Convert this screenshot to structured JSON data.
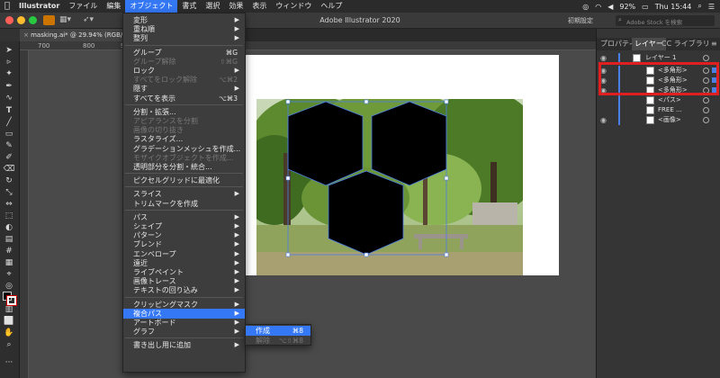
{
  "menubar": {
    "app": "Illustrator",
    "items": [
      "ファイル",
      "編集",
      "オブジェクト",
      "書式",
      "選択",
      "効果",
      "表示",
      "ウィンドウ",
      "ヘルプ"
    ],
    "active": "オブジェクト",
    "battery": "92%",
    "clock": "Thu 15:44"
  },
  "appbar": {
    "title": "Adobe Illustrator 2020",
    "workspace": "初期設定",
    "search_placeholder": "Adobe Stock を検索"
  },
  "document": {
    "tab_label": "masking.ai* @ 29.94% (RGB/GPU",
    "ruler_ticks": [
      "700",
      "800",
      "900"
    ]
  },
  "object_menu": {
    "rows": [
      {
        "label": "変形",
        "arrow": true
      },
      {
        "label": "重ね順",
        "arrow": true
      },
      {
        "label": "整列",
        "arrow": true
      },
      {
        "sep": true
      },
      {
        "label": "グループ",
        "shortcut": "⌘G"
      },
      {
        "label": "グループ解除",
        "shortcut": "⇧⌘G",
        "disabled": true
      },
      {
        "label": "ロック",
        "arrow": true
      },
      {
        "label": "すべてをロック解除",
        "shortcut": "⌥⌘2",
        "disabled": true
      },
      {
        "label": "隠す",
        "arrow": true
      },
      {
        "label": "すべてを表示",
        "shortcut": "⌥⌘3"
      },
      {
        "sep": true
      },
      {
        "label": "分割・拡張..."
      },
      {
        "label": "アピアランスを分割",
        "disabled": true
      },
      {
        "label": "画像の切り抜き",
        "disabled": true
      },
      {
        "label": "ラスタライズ..."
      },
      {
        "label": "グラデーションメッシュを作成..."
      },
      {
        "label": "モザイクオブジェクトを作成...",
        "disabled": true
      },
      {
        "label": "透明部分を分割・統合..."
      },
      {
        "sep": true
      },
      {
        "label": "ピクセルグリッドに最適化"
      },
      {
        "sep": true
      },
      {
        "label": "スライス",
        "arrow": true
      },
      {
        "label": "トリムマークを作成"
      },
      {
        "sep": true
      },
      {
        "label": "パス",
        "arrow": true
      },
      {
        "label": "シェイプ",
        "arrow": true
      },
      {
        "label": "パターン",
        "arrow": true
      },
      {
        "label": "ブレンド",
        "arrow": true
      },
      {
        "label": "エンベロープ",
        "arrow": true
      },
      {
        "label": "遠近",
        "arrow": true
      },
      {
        "label": "ライブペイント",
        "arrow": true
      },
      {
        "label": "画像トレース",
        "arrow": true
      },
      {
        "label": "テキストの回り込み",
        "arrow": true
      },
      {
        "sep": true
      },
      {
        "label": "クリッピングマスク",
        "arrow": true
      },
      {
        "label": "複合パス",
        "arrow": true,
        "highlight": true
      },
      {
        "label": "アートボード",
        "arrow": true
      },
      {
        "label": "グラフ",
        "arrow": true
      },
      {
        "sep": true
      },
      {
        "label": "書き出し用に追加",
        "arrow": true
      }
    ]
  },
  "compound_submenu": {
    "rows": [
      {
        "label": "作成",
        "shortcut": "⌘8",
        "highlight": true
      },
      {
        "label": "解除",
        "shortcut": "⌥⇧⌘8",
        "disabled": true
      }
    ]
  },
  "panel": {
    "tabs": [
      "プロパティ",
      "レイヤー",
      "CC ライブラリ"
    ],
    "active_tab": "レイヤー",
    "layers": [
      {
        "name": "レイヤー 1",
        "eye": true
      },
      {
        "name": "<多角形>",
        "eye": true,
        "selected": true
      },
      {
        "name": "<多角形>",
        "eye": true,
        "selected": true
      },
      {
        "name": "<多角形>",
        "eye": true,
        "selected": true
      },
      {
        "name": "<パス>",
        "eye": false
      },
      {
        "name": "FREE ...",
        "eye": false
      },
      {
        "name": "<画像>",
        "eye": true
      }
    ]
  },
  "colors": {
    "accent": "#3478f6",
    "highlight_box": "#e02020",
    "selection": "#4a7fe8"
  }
}
